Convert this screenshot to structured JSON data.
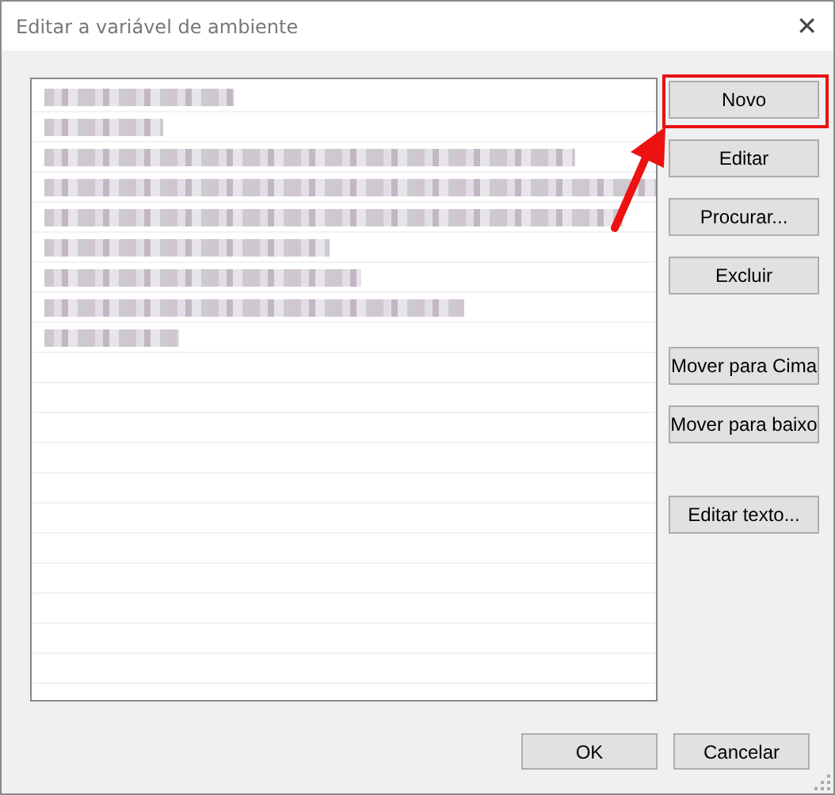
{
  "window": {
    "title": "Editar a variável de ambiente",
    "close": "✕"
  },
  "list": {
    "rows": [
      {
        "kind": "blurred"
      },
      {
        "kind": "blurred"
      },
      {
        "kind": "blurred"
      },
      {
        "kind": "blurred"
      },
      {
        "kind": "blurred"
      },
      {
        "kind": "blurred"
      },
      {
        "kind": "blurred"
      },
      {
        "kind": "blurred"
      },
      {
        "kind": "blurred"
      }
    ]
  },
  "side_buttons": [
    {
      "label": "Novo",
      "highlighted": true
    },
    {
      "label": "Editar",
      "highlighted": false
    },
    {
      "label": "Procurar...",
      "highlighted": false
    },
    {
      "label": "Excluir",
      "highlighted": false
    },
    {
      "label": "Mover para Cima",
      "highlighted": false
    },
    {
      "label": "Mover para baixo",
      "highlighted": false
    },
    {
      "label": "Editar texto...",
      "highlighted": false
    }
  ],
  "footer_buttons": [
    "OK",
    "Cancelar"
  ]
}
